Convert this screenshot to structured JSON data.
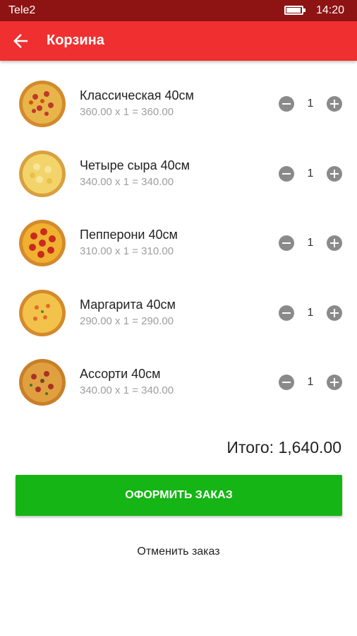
{
  "status_bar": {
    "carrier": "Tele2",
    "time": "14:20",
    "battery_level": 0.85
  },
  "app_bar": {
    "title": "Корзина",
    "back_icon": "arrow-left-icon",
    "color": "#f03030"
  },
  "cart": {
    "items": [
      {
        "name": "Классическая 40см",
        "calc": "360.00 x 1 = 360.00",
        "quantity": "1",
        "pizza": "classic"
      },
      {
        "name": "Четыре сыра 40см",
        "calc": "340.00 x 1 = 340.00",
        "quantity": "1",
        "pizza": "four-cheese"
      },
      {
        "name": "Пепперони 40см",
        "calc": "310.00 x 1 = 310.00",
        "quantity": "1",
        "pizza": "pepperoni"
      },
      {
        "name": "Маргарита 40см",
        "calc": "290.00 x 1 = 290.00",
        "quantity": "1",
        "pizza": "margherita"
      },
      {
        "name": "Ассорти 40см",
        "calc": "340.00 x 1 = 340.00",
        "quantity": "1",
        "pizza": "assorted"
      }
    ]
  },
  "total": "Итого: 1,640.00",
  "order_button": {
    "label": "ОФОРМИТЬ ЗАКАЗ",
    "color": "#14b514"
  },
  "cancel_label": "Отменить заказ"
}
